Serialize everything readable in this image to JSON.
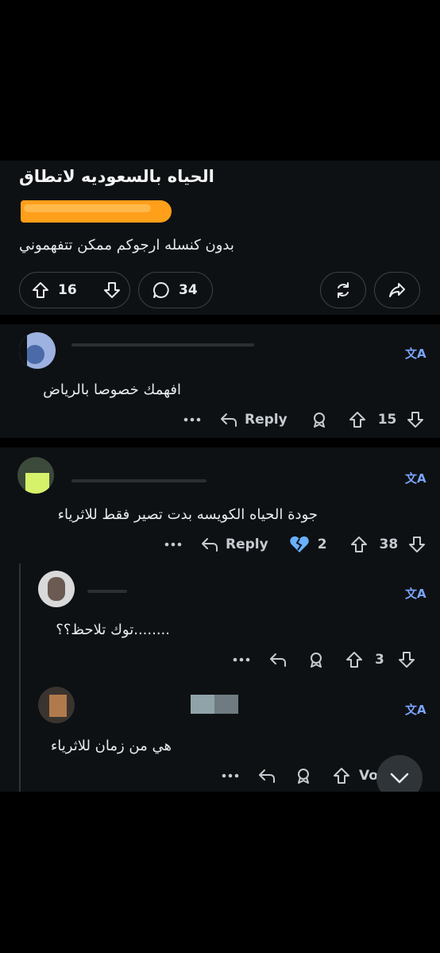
{
  "post": {
    "title": "الحياه بالسعوديه لاتطاق",
    "body": "بدون كنسله ارجوكم ممكن تتفهموني",
    "upvotes": "16",
    "comments": "34"
  },
  "comments": [
    {
      "text": "افهمك خصوصا بالرياض",
      "reply_label": "Reply",
      "score": "15"
    },
    {
      "text": "جودة الحياه الكويسه بدت تصير فقط للاثرياء",
      "reply_label": "Reply",
      "award_count": "2",
      "score": "38"
    },
    {
      "text": "توك تلاحظ؟؟........",
      "score": "3"
    },
    {
      "text": "هي من زمان للاثرياء",
      "score_partial": "Vo"
    }
  ],
  "icons": {
    "translate": "translate-icon",
    "more": "more-icon",
    "reply": "reply-icon",
    "award": "award-icon",
    "upvote": "upvote-icon",
    "downvote": "downvote-icon",
    "comment": "comment-icon",
    "share": "share-icon",
    "scroll_down": "chevron-down-icon"
  },
  "colors": {
    "background": "#0e1113",
    "flair": "#ff9f1a",
    "translate_accent": "#7aa4ff"
  }
}
